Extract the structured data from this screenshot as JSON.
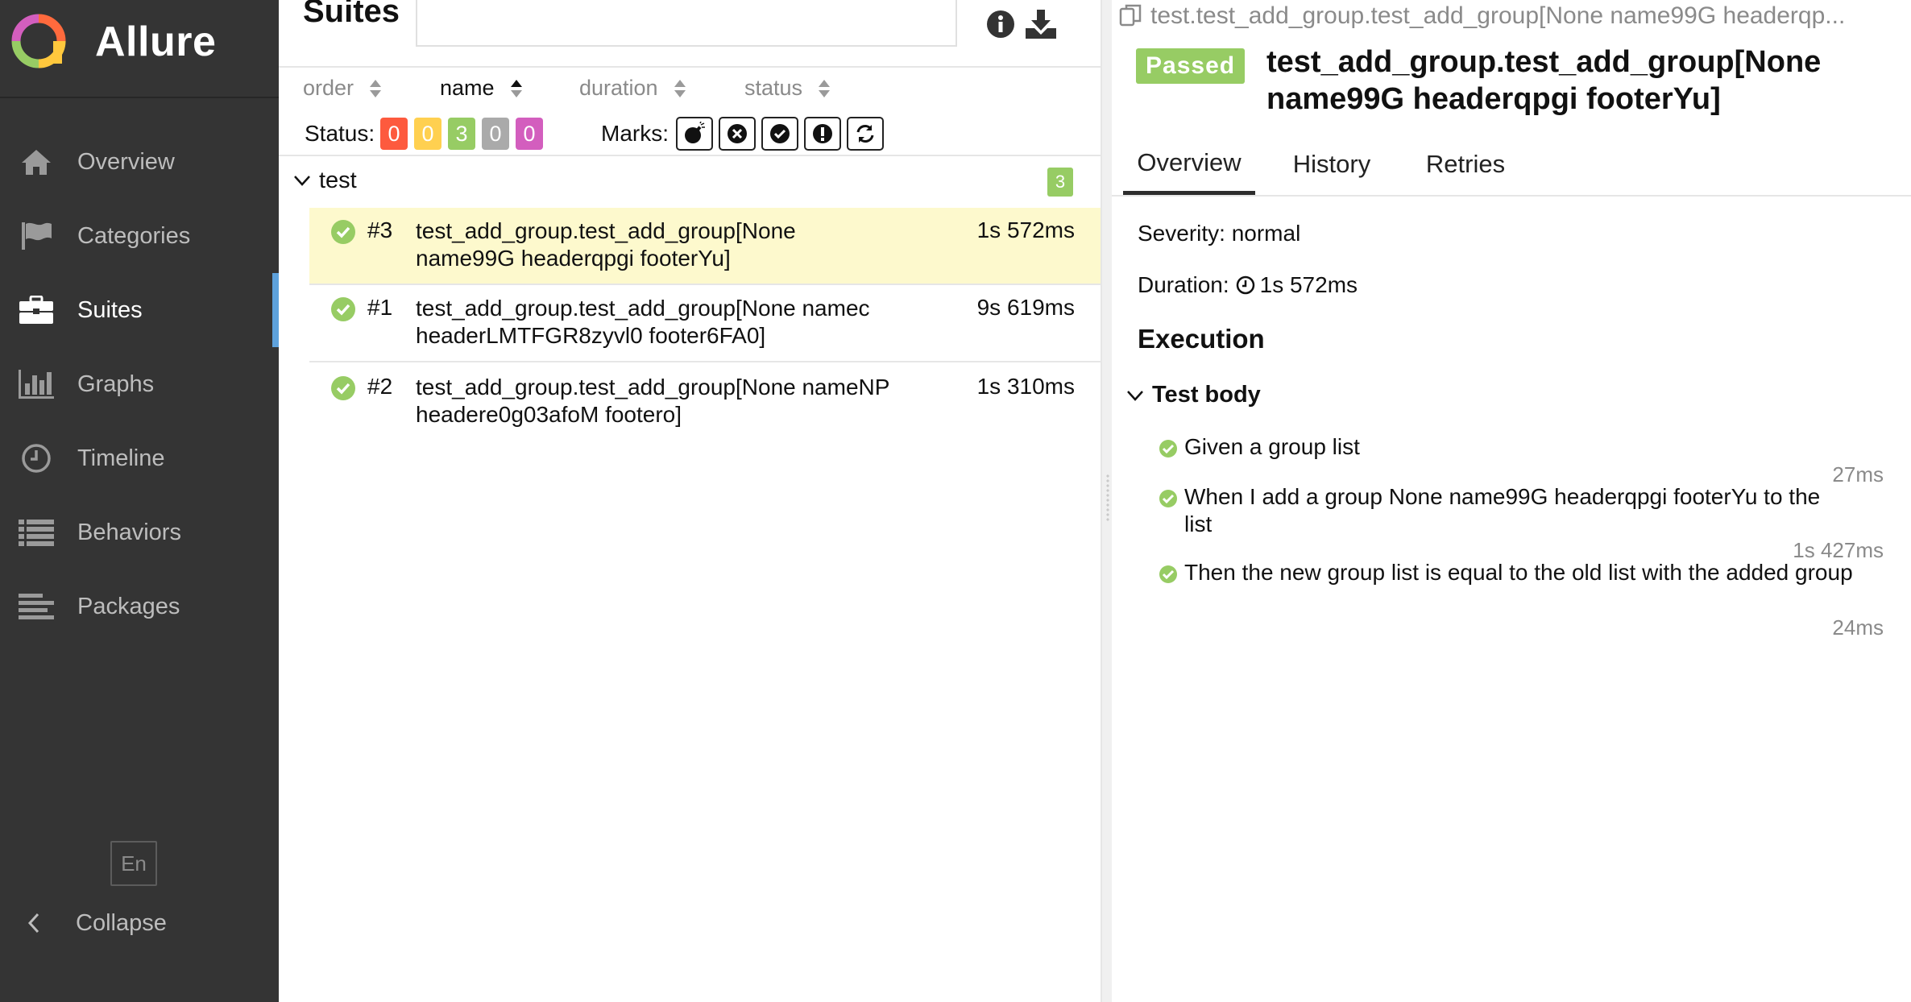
{
  "brand": {
    "name": "Allure"
  },
  "sidebar": {
    "items": [
      {
        "label": "Overview",
        "icon": "home-icon"
      },
      {
        "label": "Categories",
        "icon": "flag-icon"
      },
      {
        "label": "Suites",
        "icon": "briefcase-icon",
        "active": true
      },
      {
        "label": "Graphs",
        "icon": "bar-chart-icon"
      },
      {
        "label": "Timeline",
        "icon": "clock-icon"
      },
      {
        "label": "Behaviors",
        "icon": "list-icon"
      },
      {
        "label": "Packages",
        "icon": "align-left-icon"
      }
    ],
    "language": "En",
    "collapse_label": "Collapse"
  },
  "suites": {
    "title": "Suites",
    "search_value": "",
    "sort": {
      "order": "order",
      "name": "name",
      "duration": "duration",
      "status": "status",
      "active": "name"
    },
    "status_label": "Status:",
    "status_counts": [
      {
        "name": "failed",
        "value": "0",
        "color": "#fd5a3e"
      },
      {
        "name": "broken",
        "value": "0",
        "color": "#ffd050"
      },
      {
        "name": "passed",
        "value": "3",
        "color": "#97cc64"
      },
      {
        "name": "skipped",
        "value": "0",
        "color": "#aaaaaa"
      },
      {
        "name": "unknown",
        "value": "0",
        "color": "#d35ebe"
      }
    ],
    "marks_label": "Marks:",
    "marks": [
      "flaky-icon",
      "new-failed-icon",
      "new-passed-icon",
      "new-broken-icon",
      "retries-status-change-icon"
    ],
    "group": {
      "name": "test",
      "count": "3"
    },
    "tests": [
      {
        "num": "#3",
        "name": "test_add_group.test_add_group[None name99G headerqpgi footerYu]",
        "duration": "1s 572ms",
        "status": "passed",
        "selected": true
      },
      {
        "num": "#1",
        "name": "test_add_group.test_add_group[None namec headerLMTFGR8zyvl0 footer6FA0]",
        "duration": "9s 619ms",
        "status": "passed",
        "selected": false
      },
      {
        "num": "#2",
        "name": "test_add_group.test_add_group[None nameNP headere0g03afoM footero]",
        "duration": "1s 310ms",
        "status": "passed",
        "selected": false
      }
    ]
  },
  "detail": {
    "breadcrumb": "test.test_add_group.test_add_group[None name99G headerqp...",
    "status": "Passed",
    "title": "test_add_group.test_add_group[None name99G headerqpgi footerYu]",
    "tabs": [
      "Overview",
      "History",
      "Retries"
    ],
    "severity": "Severity: normal",
    "duration_label": "Duration:",
    "duration_value": "1s 572ms",
    "execution_title": "Execution",
    "body_title": "Test body",
    "steps": [
      {
        "text": "Given a group list",
        "time": "27ms"
      },
      {
        "text": "When I add a group None name99G headerqpgi footerYu to the list",
        "time": "1s 427ms"
      },
      {
        "text": "Then the new group list is equal to the old list with the added group",
        "time": "24ms"
      }
    ]
  },
  "colors": {
    "sidebar_bg": "#343434",
    "accent": "#5ea2dc",
    "passed": "#97cc64",
    "selected_row": "#fdf9cd"
  }
}
